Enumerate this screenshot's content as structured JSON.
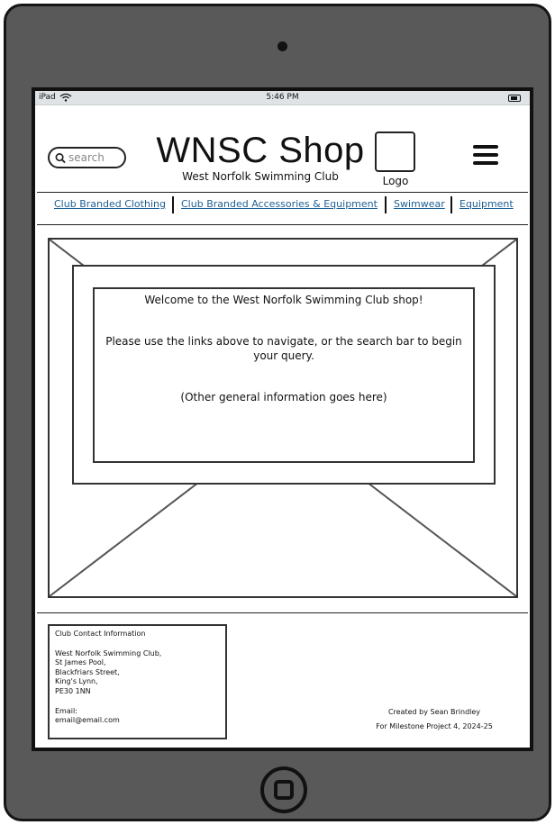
{
  "device": {
    "model_label": "iPad",
    "time": "5:46 PM"
  },
  "header": {
    "search_placeholder": "search",
    "title": "WNSC Shop",
    "subtitle": "West Norfolk Swimming Club",
    "logo_label": "Logo"
  },
  "nav": {
    "items": [
      {
        "label": "Club Branded Clothing"
      },
      {
        "label": "Club Branded Accessories & Equipment"
      },
      {
        "label": "Swimwear"
      },
      {
        "label": "Equipment"
      }
    ]
  },
  "hero": {
    "welcome": "Welcome to the West Norfolk Swimming Club shop!",
    "instructions": "Please use the links above to navigate, or the search bar to begin your query.",
    "general_info": "(Other general information goes here)"
  },
  "footer": {
    "contact": {
      "heading": "Club Contact Information",
      "address_lines": [
        "West Norfolk Swimming Club,",
        "St James Pool,",
        "Blackfriars Street,",
        "King's Lynn,",
        "PE30 1NN"
      ],
      "email_label": "Email:",
      "email": "email@email.com"
    },
    "credits": {
      "author": "Created by Sean Brindley",
      "project": "For Milestone Project 4, 2024-25"
    }
  },
  "colors": {
    "device_body": "#595959",
    "link": "#1d5f94",
    "status_bar": "#dfe3e6"
  }
}
